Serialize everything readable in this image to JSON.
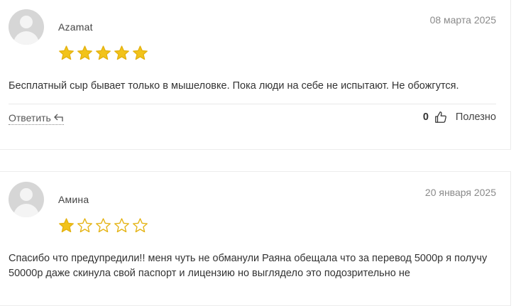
{
  "reviews": [
    {
      "author": "Azamat",
      "date": "08 марта 2025",
      "rating": 5,
      "max_rating": 5,
      "text": "Бесплатный сыр бывает только в мышеловке. Пока люди на себе не испытают. Не обожгутся.",
      "reply_label": "Ответить",
      "helpful_count": "0",
      "helpful_label": "Полезно"
    },
    {
      "author": "Амина",
      "date": "20 января 2025",
      "rating": 1,
      "max_rating": 5,
      "text": "Спасибо что предупредили!! меня чуть не обманули Раяна обещала что за перевод 5000р я получу 50000р даже скинула свой паспорт и лицензию но выглядело это подозрительно не"
    }
  ],
  "colors": {
    "star_filled": "#f2c31a",
    "star_stroke": "#e4b20f",
    "star_empty_stroke": "#e4b20f"
  },
  "icons": {
    "reply": "reply-arrow-icon",
    "helpful": "thumbs-up-icon",
    "avatar": "user-avatar-icon",
    "star": "star-icon"
  }
}
